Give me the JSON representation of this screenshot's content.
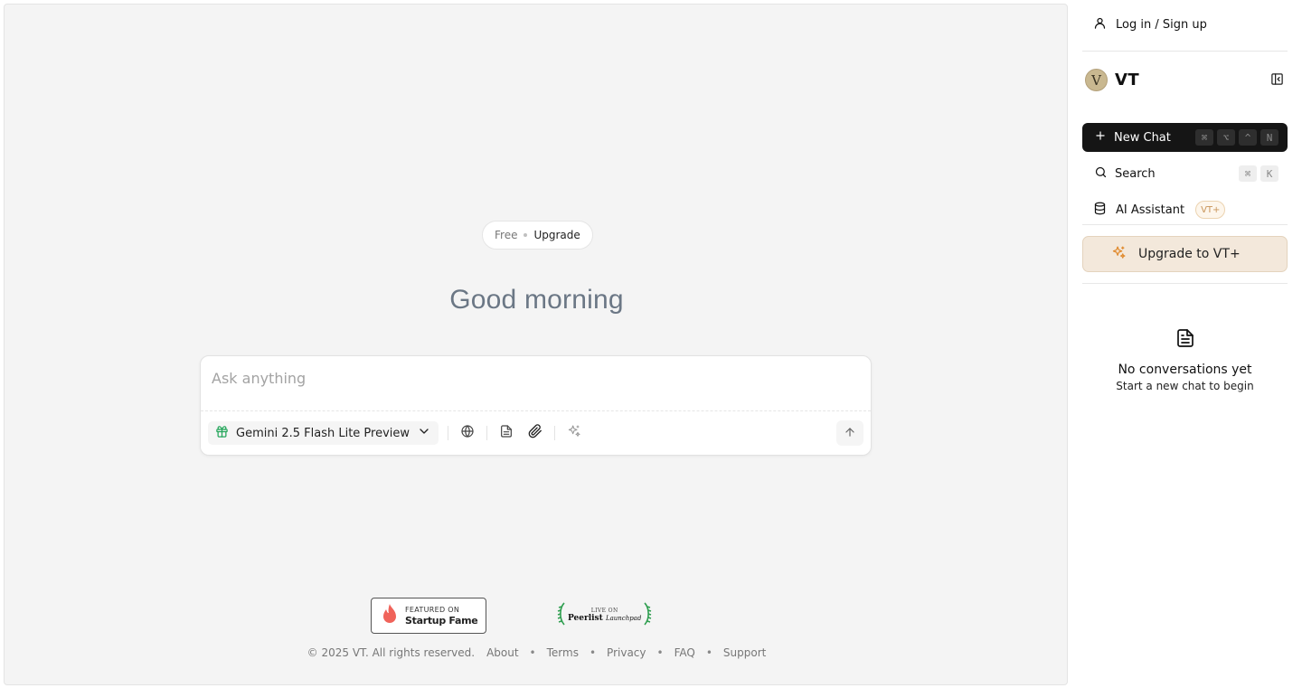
{
  "main": {
    "plan": {
      "free_label": "Free",
      "upgrade_label": "Upgrade"
    },
    "greeting": "Good morning",
    "composer": {
      "placeholder": "Ask anything",
      "model_label": "Gemini 2.5 Flash Lite Preview",
      "icons": [
        "gift-icon",
        "chevron-down-icon",
        "globe-icon",
        "document-icon",
        "paperclip-icon",
        "sparkle-icon",
        "arrow-up-icon"
      ]
    },
    "badges": {
      "startup_fame": {
        "small": "FEATURED ON",
        "big": "Startup Fame"
      },
      "peerlist": {
        "small": "LIVE ON",
        "big": "Peerlist",
        "script": "Launchpad"
      }
    },
    "footer": {
      "copyright": "© 2025 VT. All rights reserved.",
      "links": [
        "About",
        "Terms",
        "Privacy",
        "FAQ",
        "Support"
      ]
    }
  },
  "sidebar": {
    "login_label": "Log in / Sign up",
    "brand_name": "VT",
    "new_chat": {
      "label": "New Chat",
      "keys": [
        "⌘",
        "⌥",
        "^",
        "N"
      ]
    },
    "search": {
      "label": "Search",
      "keys": [
        "⌘",
        "K"
      ]
    },
    "assistant": {
      "label": "AI Assistant",
      "badge": "VT+"
    },
    "upgrade_label": "Upgrade to VT+",
    "empty": {
      "title": "No conversations yet",
      "subtitle": "Start a new chat to begin"
    }
  },
  "colors": {
    "accent_green": "#22a559",
    "upgrade_orange": "#e08a2e",
    "greeting": "#6b7785"
  }
}
